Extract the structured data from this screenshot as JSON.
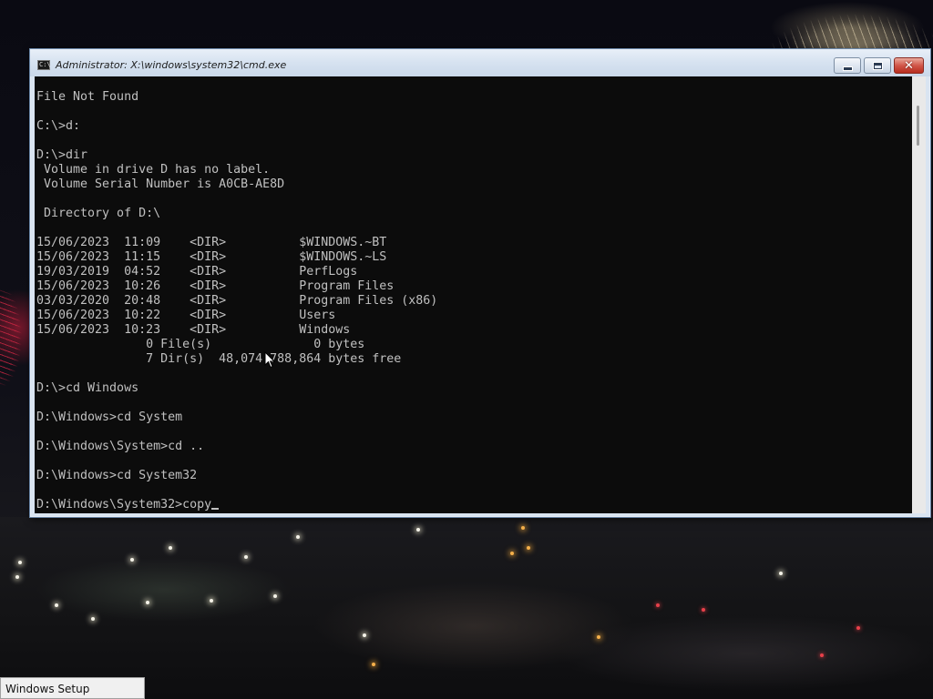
{
  "window": {
    "title": "Administrator: X:\\windows\\system32\\cmd.exe",
    "icon_text": "C:\\",
    "controls": {
      "minimize": "minimize",
      "maximize": "maximize",
      "close": "✕"
    }
  },
  "console": {
    "lines": [
      "File Not Found",
      "",
      "C:\\>d:",
      "",
      "D:\\>dir",
      " Volume in drive D has no label.",
      " Volume Serial Number is A0CB-AE8D",
      "",
      " Directory of D:\\",
      "",
      "15/06/2023  11:09    <DIR>          $WINDOWS.~BT",
      "15/06/2023  11:15    <DIR>          $WINDOWS.~LS",
      "19/03/2019  04:52    <DIR>          PerfLogs",
      "15/06/2023  10:26    <DIR>          Program Files",
      "03/03/2020  20:48    <DIR>          Program Files (x86)",
      "15/06/2023  10:22    <DIR>          Users",
      "15/06/2023  10:23    <DIR>          Windows",
      "               0 File(s)              0 bytes",
      "               7 Dir(s)  48,074,788,864 bytes free",
      "",
      "D:\\>cd Windows",
      "",
      "D:\\Windows>cd System",
      "",
      "D:\\Windows\\System>cd ..",
      "",
      "D:\\Windows>cd System32",
      ""
    ],
    "prompt": "D:\\Windows\\System32>",
    "input": "copy",
    "colors": {
      "background": "#0c0c0c",
      "text": "#c0c0c0"
    }
  },
  "taskbar": {
    "setup_label": "Windows Setup"
  },
  "icons": {
    "app": "cmd-icon",
    "cursor": "mouse-pointer-icon"
  }
}
